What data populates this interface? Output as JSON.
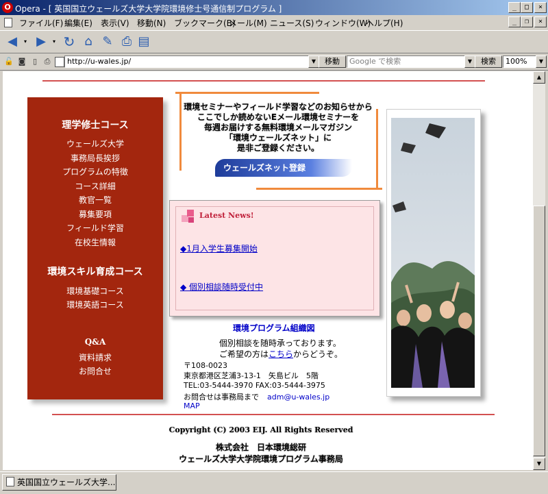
{
  "window": {
    "title": "Opera - [ 英国国立ウェールズ大学大学院環境修士号通信制プログラム ]",
    "app_icon": "opera-icon",
    "controls": [
      "minimize",
      "maximize",
      "close"
    ]
  },
  "menu": [
    "ファイル(F)",
    "編集(E)",
    "表示(V)",
    "移動(N)",
    "ブックマーク(B)",
    "メール(M)",
    "ニュース(S)",
    "ウィンドウ(W)",
    "ヘルプ(H)"
  ],
  "toolbar": {
    "icons": [
      "back-icon",
      "forward-icon",
      "reload-icon",
      "home-icon",
      "hotlist-icon",
      "print-icon",
      "page-icon"
    ]
  },
  "address": {
    "url": "http://u-wales.jp/",
    "go_label": "移動",
    "search_placeholder": "Google で検索",
    "search_label": "検索",
    "zoom": "100%"
  },
  "sidebar": {
    "heading1": "理学修士コース",
    "links1": [
      "ウェールズ大学",
      "事務局長挨拶",
      "プログラムの特徴",
      "コース詳細",
      "教官一覧",
      "募集要項",
      "フィールド学習",
      "在校生情報"
    ],
    "heading2": "環境スキル育成コース",
    "links2": [
      "環境基礎コース",
      "環境英語コース"
    ],
    "links3": [
      "Q&A",
      "資料請求",
      "お問合せ"
    ]
  },
  "promo": {
    "lines": [
      "環境セミナーやフィールド学習などのお知らせから",
      "ここでしか読めないEメール環境セミナーを",
      "毎週お届けする無料環境メールマガジン",
      "「環境ウェールズネット」に",
      "是非ご登録ください。"
    ],
    "button": "ウェールズネット登録"
  },
  "news": {
    "title": "Latest News!",
    "items": [
      "◆1月入学生募集開始",
      "◆ 個別相談随時受付中"
    ]
  },
  "info": {
    "org_chart_link": "環境プログラム組織図",
    "consult_line1": "個別相談を随時承っております。",
    "consult_pre": "ご希望の方は",
    "consult_link": "こちら",
    "consult_post": "からどうぞ。",
    "postal": "〒108-0023",
    "address": "東京都港区芝浦3-13-1　矢島ビル　5階",
    "tel_fax": "TEL:03-5444-3970 FAX:03-5444-3975",
    "contact_pre": "お問合せは事務局まで",
    "email": "adm@u-wales.jp",
    "map": "MAP"
  },
  "footer": {
    "copyright": "Copyright (C) 2003 EIJ. All Rights Reserved",
    "company": "株式会社　日本環境総研",
    "office": "ウェールズ大学大学院環境プログラム事務局"
  },
  "status": {
    "tab_title": "英国国立ウェールズ大学..."
  },
  "colors": {
    "sidebar_bg": "#a3260e",
    "accent_orange": "#f08a3c",
    "news_bg": "#fde4e6",
    "link": "#0000c8",
    "rule_red": "#d35050"
  }
}
